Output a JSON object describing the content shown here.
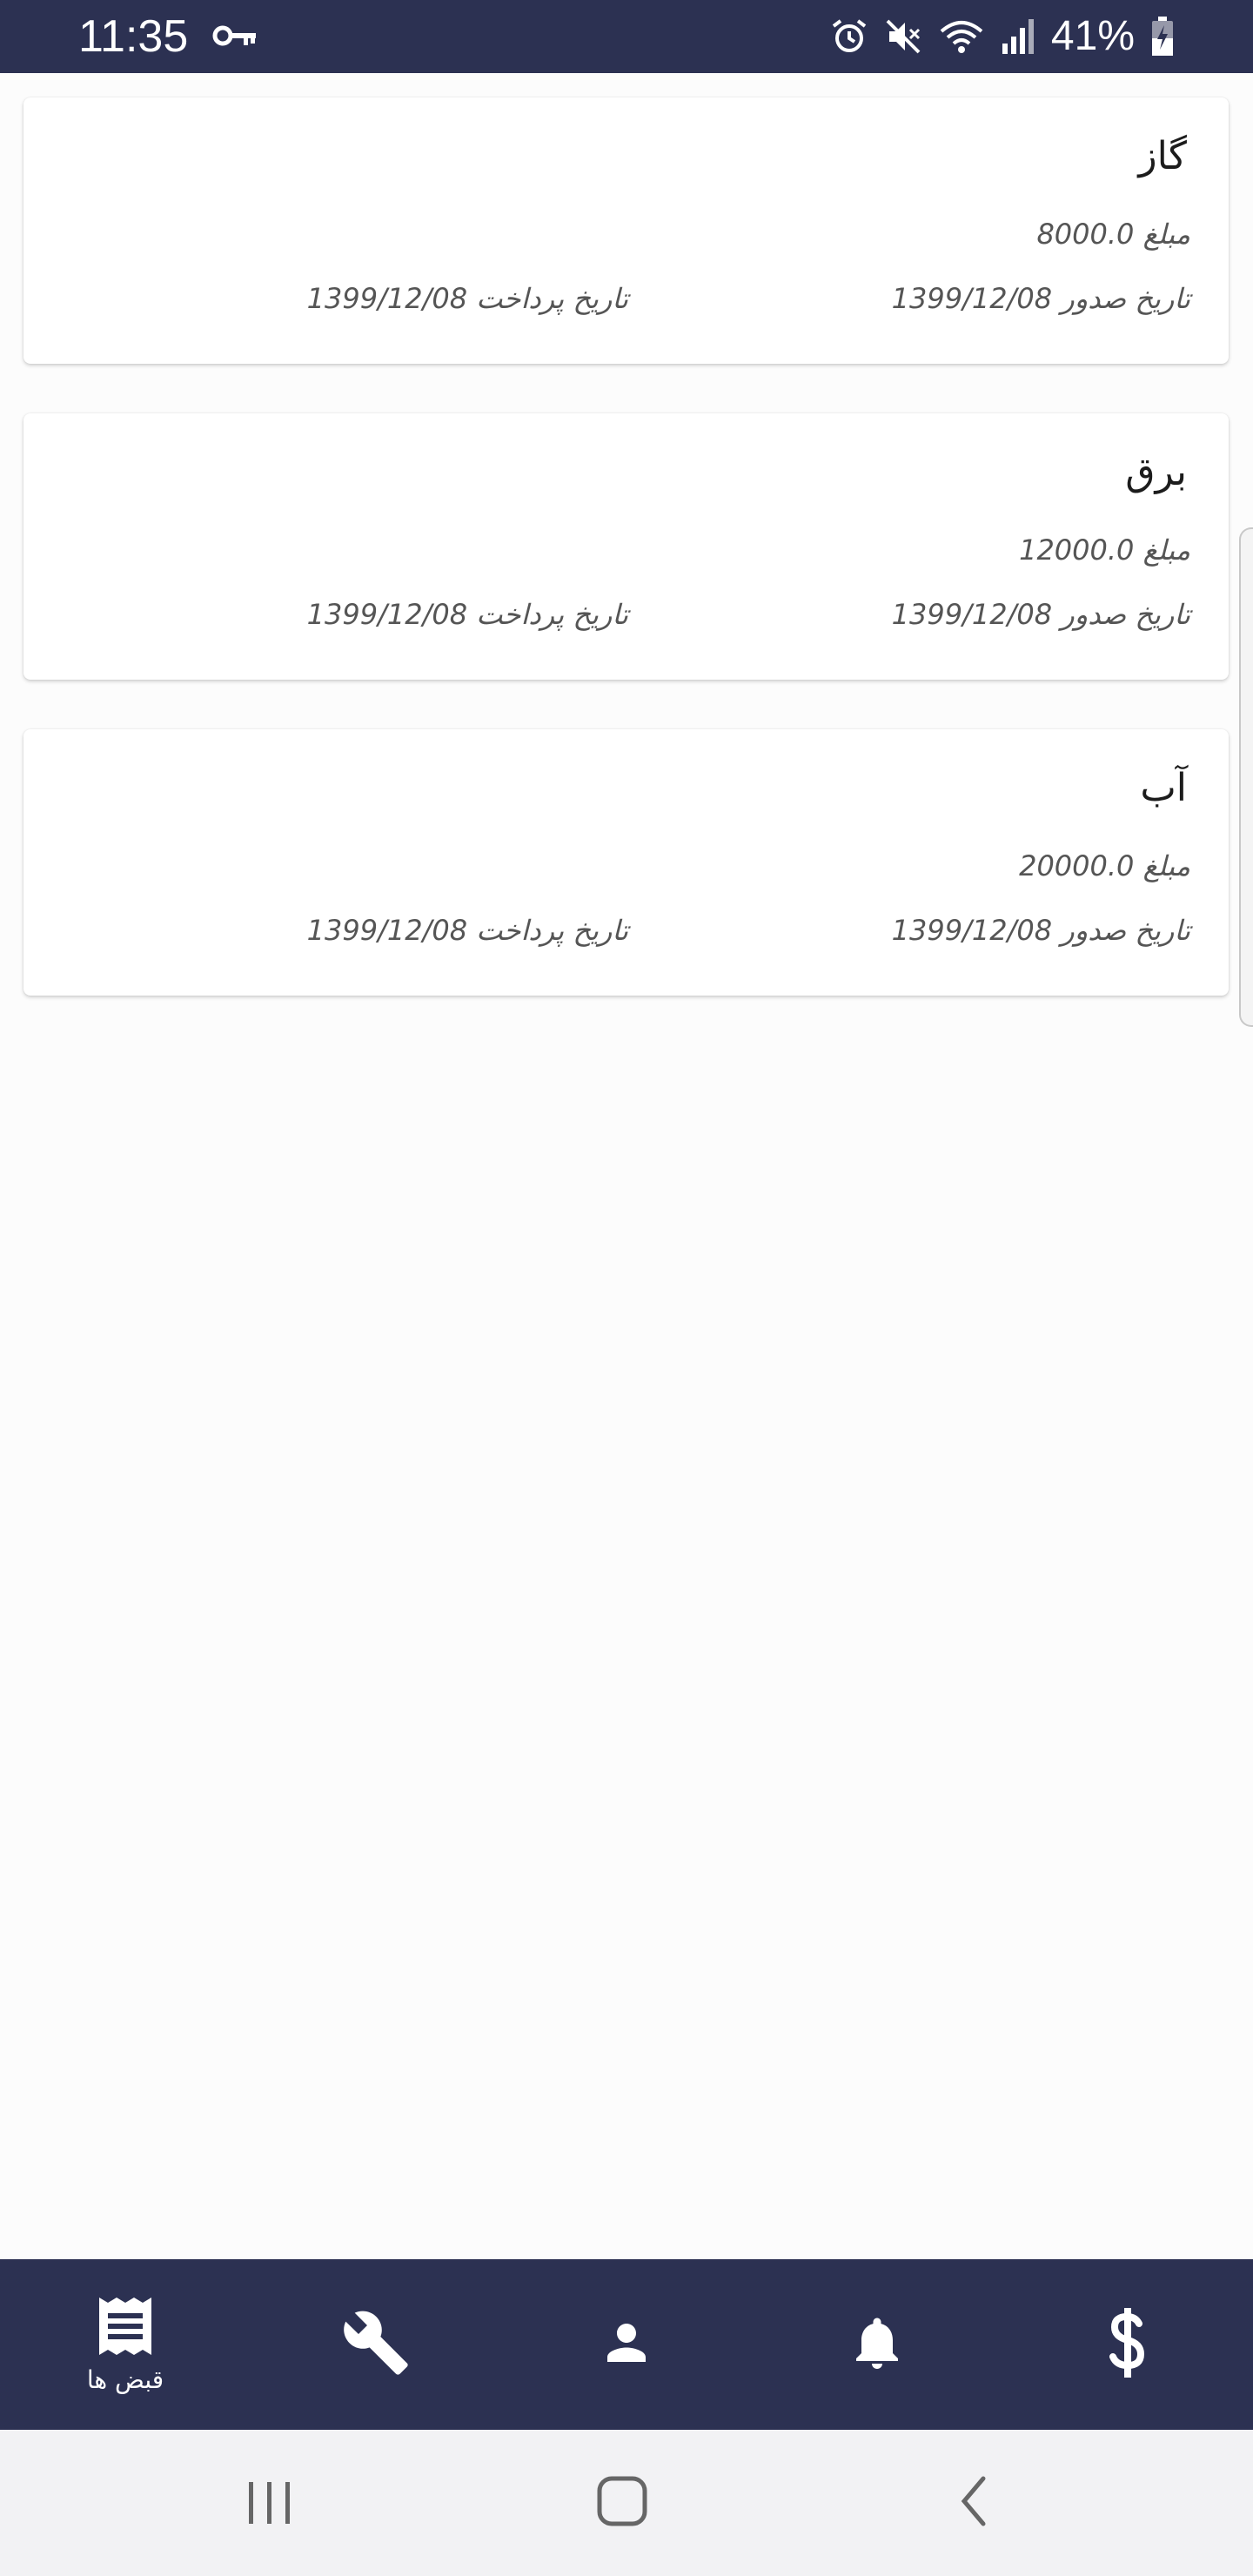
{
  "status_bar": {
    "time": "11:35",
    "battery": "41%",
    "icons": [
      "key-icon",
      "alarm-icon",
      "mute-icon",
      "wifi-icon",
      "signal-icon",
      "battery-icon"
    ],
    "color": "#2c3152"
  },
  "bills": [
    {
      "title": "گاز",
      "amount": "مبلغ 8000.0",
      "issue_date": "تاریخ صدور 1399/12/08",
      "pay_date": "تاریخ پرداخت 1399/12/08"
    },
    {
      "title": "برق",
      "amount": "مبلغ 12000.0",
      "issue_date": "تاریخ صدور 1399/12/08",
      "pay_date": "تاریخ پرداخت 1399/12/08"
    },
    {
      "title": "آب",
      "amount": "مبلغ 20000.0",
      "issue_date": "تاریخ صدور 1399/12/08",
      "pay_date": "تاریخ پرداخت 1399/12/08"
    }
  ],
  "bottom_nav": {
    "items": [
      {
        "icon": "receipt-icon",
        "label": "قبض ها",
        "active": true
      },
      {
        "icon": "wrench-icon"
      },
      {
        "icon": "person-icon"
      },
      {
        "icon": "bell-icon"
      },
      {
        "icon": "dollar-icon"
      }
    ],
    "color": "#2c3152"
  },
  "android_nav": {
    "buttons": [
      "recents-icon",
      "home-icon",
      "back-icon"
    ]
  }
}
